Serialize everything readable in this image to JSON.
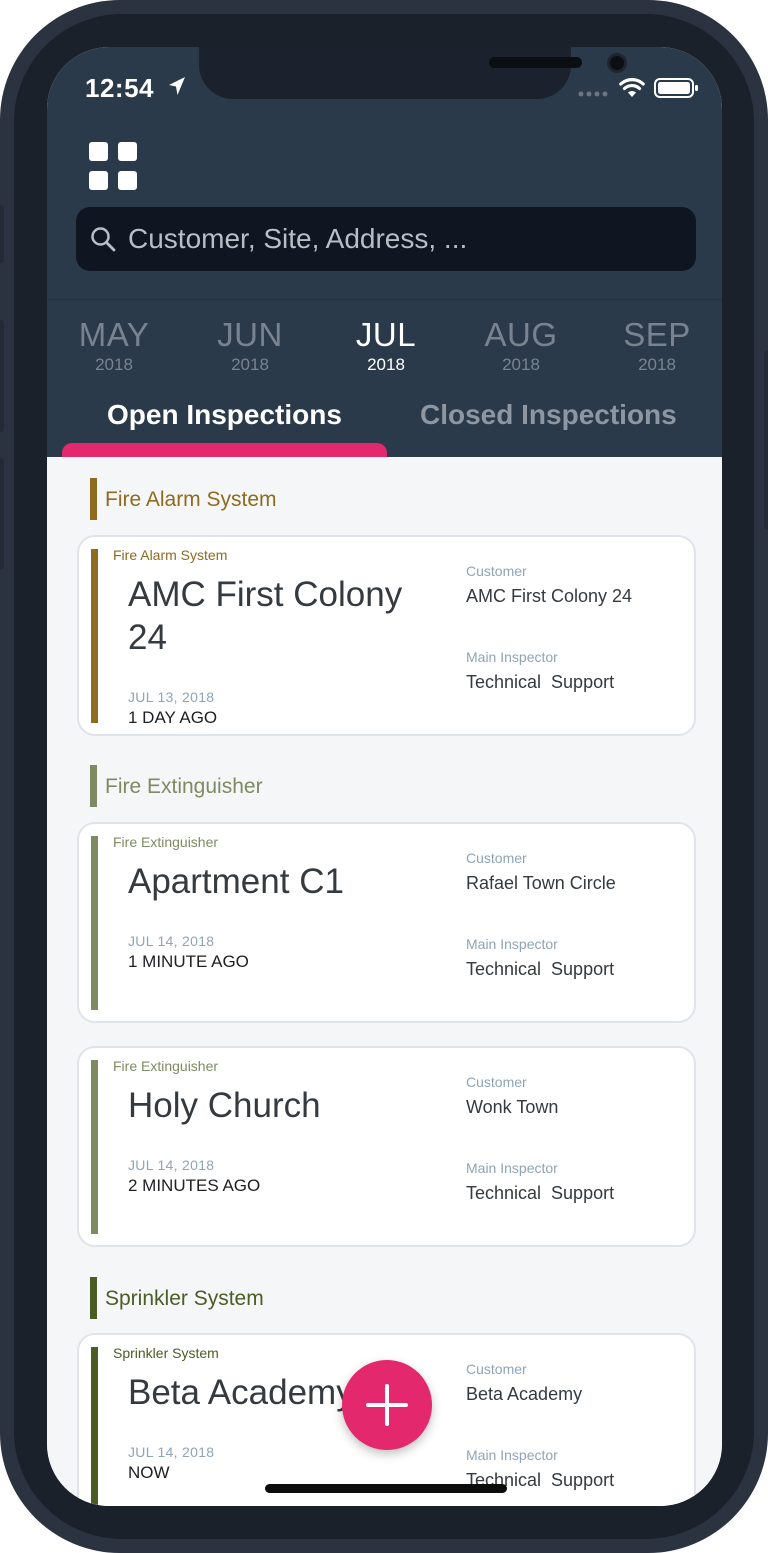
{
  "status_bar": {
    "time": "12:54"
  },
  "search": {
    "placeholder": "Customer, Site, Address, ..."
  },
  "months": [
    {
      "month": "MAY",
      "year": "2018",
      "active": false
    },
    {
      "month": "JUN",
      "year": "2018",
      "active": false
    },
    {
      "month": "JUL",
      "year": "2018",
      "active": true
    },
    {
      "month": "AUG",
      "year": "2018",
      "active": false
    },
    {
      "month": "SEP",
      "year": "2018",
      "active": false
    }
  ],
  "tabs": {
    "open": "Open Inspections",
    "closed": "Closed Inspections",
    "selected": "open"
  },
  "labels": {
    "customer": "Customer",
    "main_inspector": "Main Inspector"
  },
  "sections": [
    {
      "title": "Fire Alarm System",
      "color": "#8d6b1f",
      "cards": [
        {
          "category": "Fire Alarm System",
          "title": "AMC First Colony 24",
          "date": "JUL 13, 2018",
          "ago": "1 DAY AGO",
          "customer": "AMC First Colony 24",
          "inspector": "Technical  Support"
        }
      ]
    },
    {
      "title": "Fire Extinguisher",
      "color": "#7e8b62",
      "cards": [
        {
          "category": "Fire Extinguisher",
          "title": "Apartment C1",
          "date": "JUL 14, 2018",
          "ago": "1 MINUTE AGO",
          "customer": "Rafael Town Circle",
          "inspector": "Technical  Support"
        },
        {
          "category": "Fire Extinguisher",
          "title": "Holy Church",
          "date": "JUL 14, 2018",
          "ago": "2 MINUTES AGO",
          "customer": "Wonk Town",
          "inspector": "Technical  Support"
        }
      ]
    },
    {
      "title": "Sprinkler System",
      "color": "#4b5d24",
      "cards": [
        {
          "category": "Sprinkler System",
          "title": "Beta Academy",
          "date": "JUL 14, 2018",
          "ago": "NOW",
          "customer": "Beta Academy",
          "inspector": "Technical  Support"
        }
      ]
    }
  ],
  "colors": {
    "header": "#2b3a4a",
    "accent": "#e3286d",
    "background": "#f4f6f8"
  }
}
